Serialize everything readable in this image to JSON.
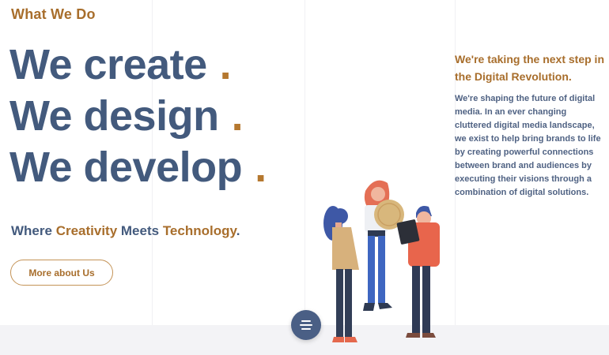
{
  "section": {
    "eyebrow": "What We Do",
    "headlines": [
      "We create",
      "We design",
      "We develop"
    ],
    "dot": ".",
    "tagline": {
      "part1": "Where ",
      "accent1": "Creativity",
      "part2": " Meets ",
      "accent2": "Technology",
      "part3": "."
    },
    "more_button_label": "More about Us"
  },
  "sidebar": {
    "title": "We're taking the next step in the Digital Revolution.",
    "body": "We're shaping the future of digital media. In an ever changing cluttered digital media landscape, we exist to help bring brands to life by creating powerful connections between brand and audiences by executing their visions through a combination of digital solutions."
  },
  "menu": {
    "icon": "hamburger-menu-icon"
  },
  "colors": {
    "heading": "#435a7d",
    "accent": "#a86e2c",
    "menu_button": "#4a5f85"
  }
}
